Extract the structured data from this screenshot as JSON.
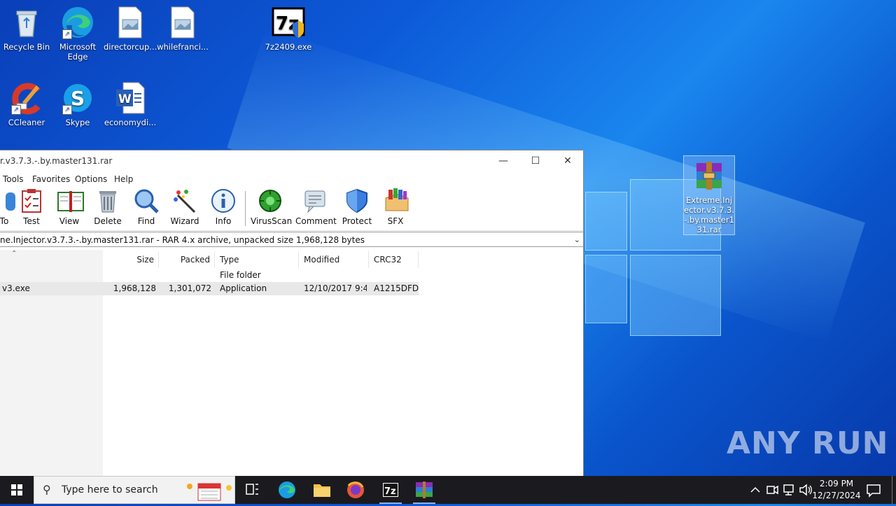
{
  "desktop": {
    "icons": [
      {
        "label": "Recycle Bin"
      },
      {
        "label": "Microsoft Edge"
      },
      {
        "label": "directorcup..."
      },
      {
        "label": "whilefranci..."
      },
      {
        "label": "7z2409.exe"
      },
      {
        "label": "CCleaner"
      },
      {
        "label": "Skype"
      },
      {
        "label": "economydi..."
      },
      {
        "label": "Extreme.Injector.v3.7.3.-.by.master131.rar"
      }
    ]
  },
  "window": {
    "title": "r.v3.7.3.-.by.master131.rar",
    "menu": [
      "Tools",
      "Favorites",
      "Options",
      "Help"
    ],
    "toolbar": [
      {
        "label": "To",
        "icon": "extract-to-icon"
      },
      {
        "label": "Test",
        "icon": "test-icon"
      },
      {
        "label": "View",
        "icon": "view-book-icon"
      },
      {
        "label": "Delete",
        "icon": "trash-icon"
      },
      {
        "label": "Find",
        "icon": "magnifier-icon"
      },
      {
        "label": "Wizard",
        "icon": "wand-icon"
      },
      {
        "label": "Info",
        "icon": "info-icon"
      },
      {
        "label": "VirusScan",
        "icon": "virus-icon"
      },
      {
        "label": "Comment",
        "icon": "comment-icon"
      },
      {
        "label": "Protect",
        "icon": "shield-icon"
      },
      {
        "label": "SFX",
        "icon": "sfx-box-icon"
      }
    ],
    "address": "ne.Injector.v3.7.3.-.by.master131.rar - RAR 4.x archive, unpacked size 1,968,128 bytes",
    "columns": [
      "Size",
      "Packed",
      "Type",
      "Modified",
      "CRC32"
    ],
    "rows": [
      {
        "name": "",
        "size": "",
        "packed": "",
        "type": "File folder",
        "modified": "",
        "crc": ""
      },
      {
        "name": "v3.exe",
        "size": "1,968,128",
        "packed": "1,301,072",
        "type": "Application",
        "modified": "12/10/2017 9:4...",
        "crc": "A1215DFD"
      }
    ]
  },
  "taskbar": {
    "search_placeholder": "Type here to search",
    "time": "2:09 PM",
    "date": "12/27/2024"
  },
  "watermark": "ANY RUN"
}
